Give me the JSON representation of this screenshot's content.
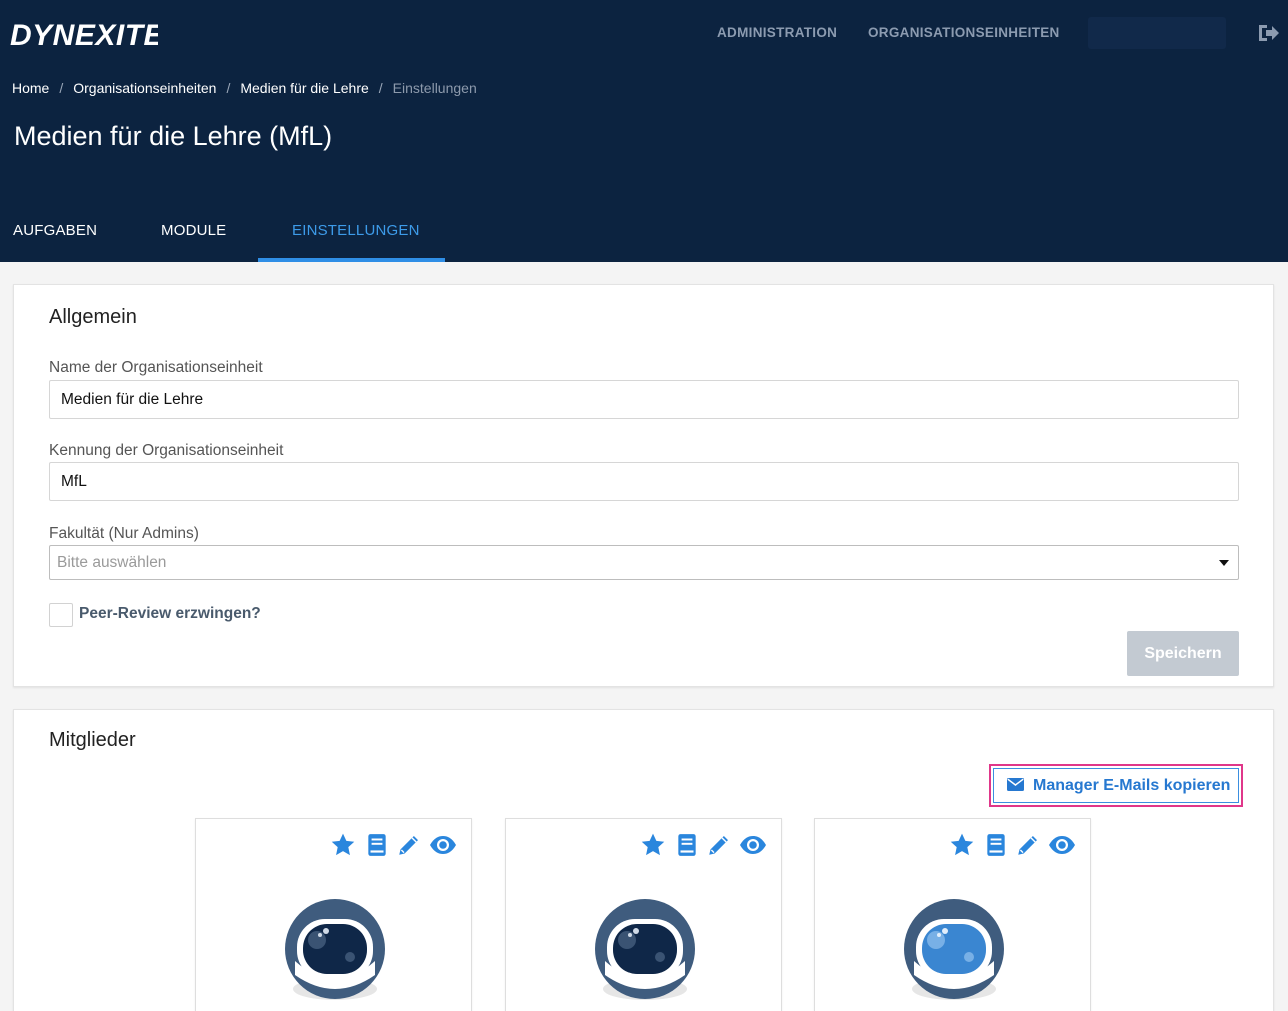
{
  "header": {
    "logo_text": "DYNEXITE",
    "nav": [
      "ADMINISTRATION",
      "ORGANISATIONSEINHEITEN"
    ],
    "colors": {
      "background": "#0c2340",
      "accent": "#2f8ee6"
    }
  },
  "breadcrumb": [
    "Home",
    "Organisationseinheiten",
    "Medien für die Lehre",
    "Einstellungen"
  ],
  "page_title": "Medien für die Lehre (MfL)",
  "tabs": [
    {
      "label": "AUFGABEN",
      "active": false
    },
    {
      "label": "MODULE",
      "active": false
    },
    {
      "label": "EINSTELLUNGEN",
      "active": true
    }
  ],
  "general": {
    "title": "Allgemein",
    "name_label": "Name der Organisationseinheit",
    "name_value": "Medien für die Lehre",
    "code_label": "Kennung der Organisationseinheit",
    "code_value": "MfL",
    "faculty_label": "Fakultät (Nur Admins)",
    "faculty_placeholder": "Bitte auswählen",
    "peer_review_label": "Peer-Review erzwingen?",
    "peer_review_checked": false,
    "save_label": "Speichern"
  },
  "members": {
    "title": "Mitglieder",
    "copy_emails_label": "Manager E-Mails kopieren",
    "cards": [
      {
        "icons": [
          "star-icon",
          "book-icon",
          "pencil-icon",
          "eye-icon"
        ],
        "avatar_visor": "#0f2748"
      },
      {
        "icons": [
          "star-icon",
          "book-icon",
          "pencil-icon",
          "eye-icon"
        ],
        "avatar_visor": "#0f2748"
      },
      {
        "icons": [
          "star-icon",
          "book-icon",
          "pencil-icon",
          "eye-icon"
        ],
        "avatar_visor": "#3a86d1"
      }
    ]
  }
}
